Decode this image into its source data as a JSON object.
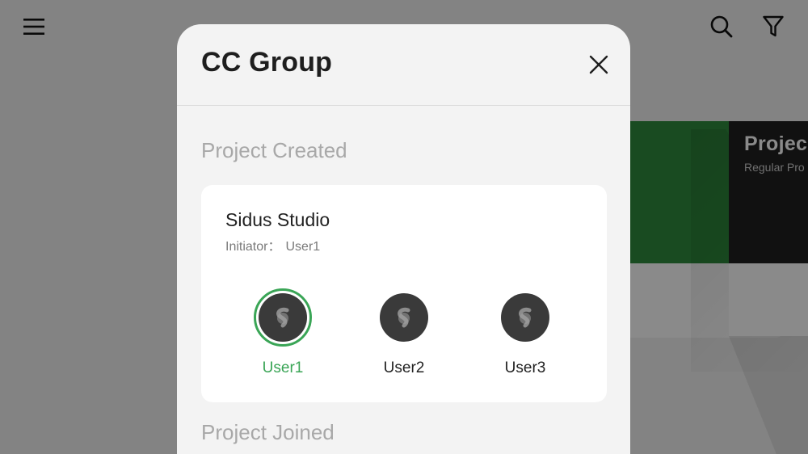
{
  "topbar": {
    "menu_icon": "hamburger-menu-icon",
    "search_icon": "search-icon",
    "filter_icon": "filter-icon"
  },
  "background_cards": [
    {
      "title": "",
      "subtitle": "",
      "color": "#2f8b3d"
    },
    {
      "title": "Projec",
      "subtitle": "Regular Pro",
      "color": "#202020"
    }
  ],
  "modal": {
    "title": "CC Group",
    "close_icon": "close-icon",
    "sections": [
      {
        "title": "Project Created",
        "projects": [
          {
            "name": "Sidus Studio",
            "initiator_label": "Initiator：",
            "initiator_value": "User1",
            "members": [
              {
                "name": "User1",
                "selected": true
              },
              {
                "name": "User2",
                "selected": false
              },
              {
                "name": "User3",
                "selected": false
              }
            ]
          }
        ]
      },
      {
        "title": "Project Joined",
        "projects": []
      }
    ]
  },
  "colors": {
    "accent": "#3aa556",
    "overlay": "rgba(0,0,0,0.46)",
    "avatar_bg": "#3a3a3a"
  }
}
